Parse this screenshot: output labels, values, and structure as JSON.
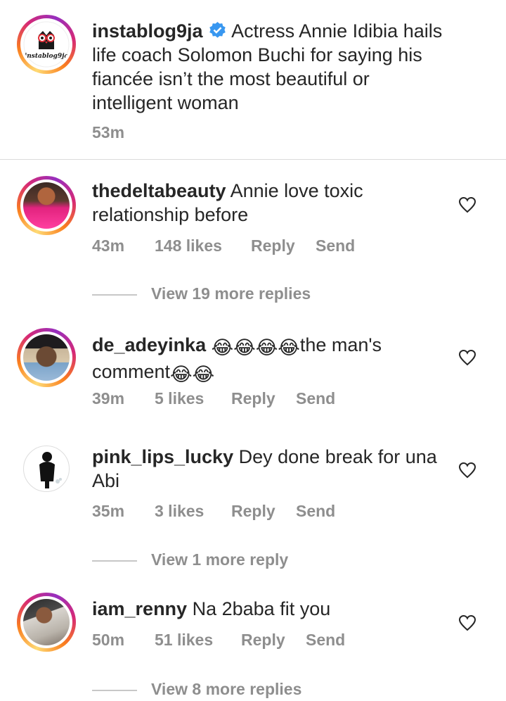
{
  "post": {
    "username": "instablog9ja",
    "caption": "Actress Annie Idibia hails life coach Solomon Buchi for saying his fiancée isn’t the most beautiful or intelligent woman",
    "time": "53m",
    "logo_text": "instablog9ja"
  },
  "labels": {
    "reply": "Reply",
    "send": "Send"
  },
  "comments": [
    {
      "username": "thedeltabeauty",
      "text": "Annie love toxic relationship before",
      "time": "43m",
      "likes": "148 likes",
      "view_more": "View 19 more replies"
    },
    {
      "username": "de_adeyinka",
      "emoji_a": "😂😂😂😂",
      "text": "the man's comment",
      "emoji_b": "😂😂",
      "time": "39m",
      "likes": "5 likes"
    },
    {
      "username": "pink_lips_lucky",
      "text": "Dey done break for una Abi",
      "time": "35m",
      "likes": "3 likes",
      "view_more": "View 1 more reply"
    },
    {
      "username": "iam_renny",
      "text": "Na 2baba fit you",
      "time": "50m",
      "likes": "51 likes",
      "view_more": "View 8 more replies"
    }
  ]
}
